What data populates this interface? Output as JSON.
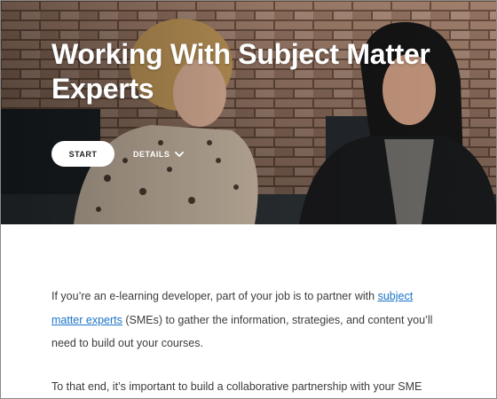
{
  "hero": {
    "title": "Working With Subject Matter Experts",
    "start_label": "START",
    "details_label": "DETAILS",
    "details_icon": "chevron-down-icon",
    "colors": {
      "title_text": "#ffffff",
      "start_button_bg": "#ffffff"
    }
  },
  "content": {
    "paragraph1": {
      "before": "If you’re an e-learning developer, part of your job is to partner with ",
      "link": "subject matter experts",
      "after": " (SMEs) to gather the information, strategies, and content you’ll need to build out your courses."
    },
    "paragraph2": "To that end, it’s important to build a collaborative partnership with your SME",
    "colors": {
      "body_text": "#3c3c3c",
      "link": "#1a73c8"
    }
  }
}
